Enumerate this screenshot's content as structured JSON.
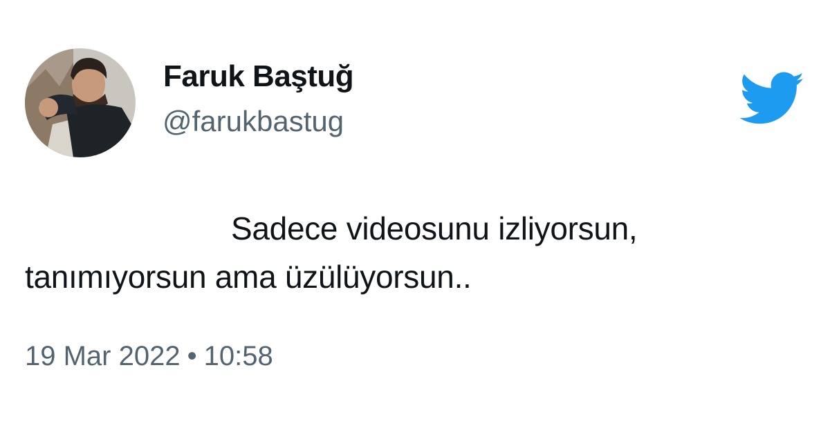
{
  "author": {
    "name": "Faruk Baştuğ",
    "handle": "@farukbastug",
    "avatar_icon": "profile-photo"
  },
  "platform": {
    "icon": "twitter-bird-icon",
    "brand_color": "#1d9bf0"
  },
  "tweet": {
    "text": "Sadece videosunu izliyorsun, tanımıyorsun ama üzülüyorsun..",
    "date": "19 Mar 2022",
    "separator": "•",
    "time": "10:58"
  }
}
